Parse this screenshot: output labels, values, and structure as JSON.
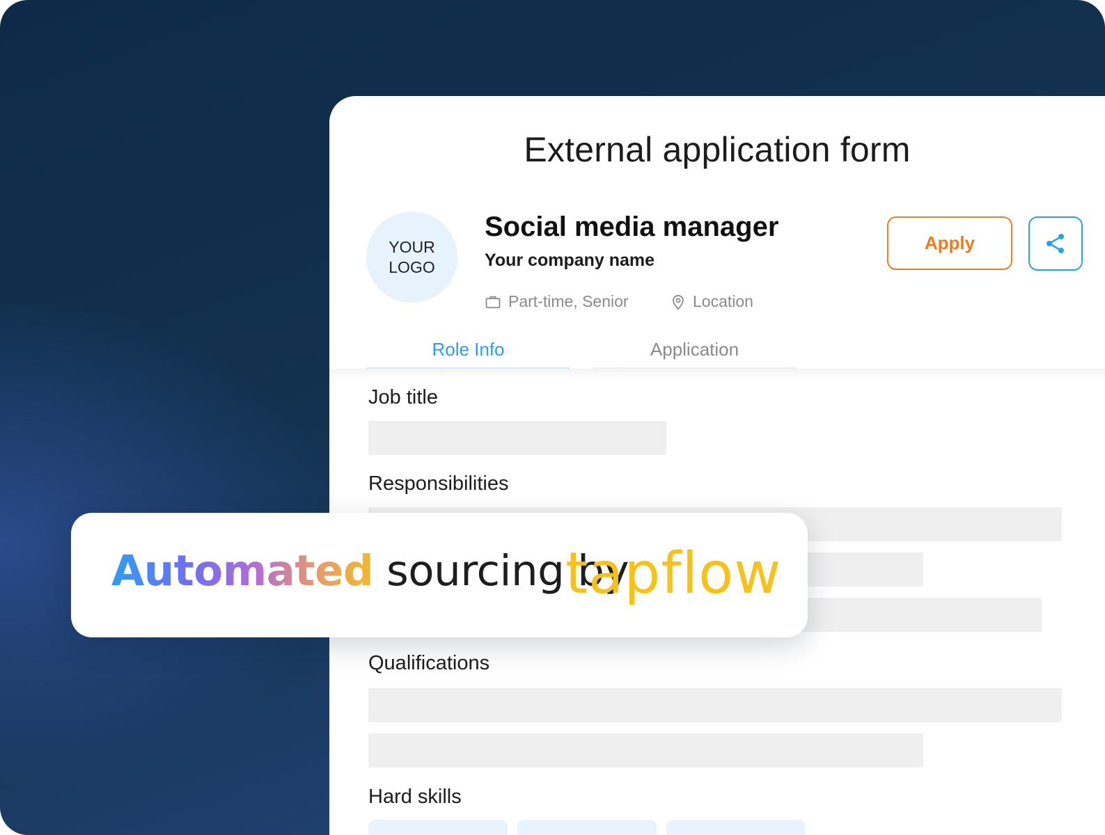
{
  "form": {
    "title": "External application form",
    "logo_text": "YOUR\nLOGO",
    "job_title": "Social media manager",
    "company": "Your company name",
    "employment": "Part-time, Senior",
    "location": "Location",
    "apply_label": "Apply",
    "tabs": [
      {
        "label": "Role Info",
        "active": true
      },
      {
        "label": "Application",
        "active": false
      }
    ],
    "sections": {
      "job_title": "Job title",
      "responsibilities": "Responsibilities",
      "qualifications": "Qualifications",
      "hard_skills": "Hard skills"
    }
  },
  "banner": {
    "highlight": "Automated",
    "text": " sourcing by ",
    "brand": "tapflow"
  },
  "colors": {
    "accent_orange": "#f07b1c",
    "accent_blue": "#2aa1e6",
    "brand_yellow": "#f6c21a",
    "background_navy": "#0e2a48"
  },
  "icons": {
    "share": "share-icon",
    "briefcase": "briefcase-icon",
    "location": "map-pin-icon"
  }
}
